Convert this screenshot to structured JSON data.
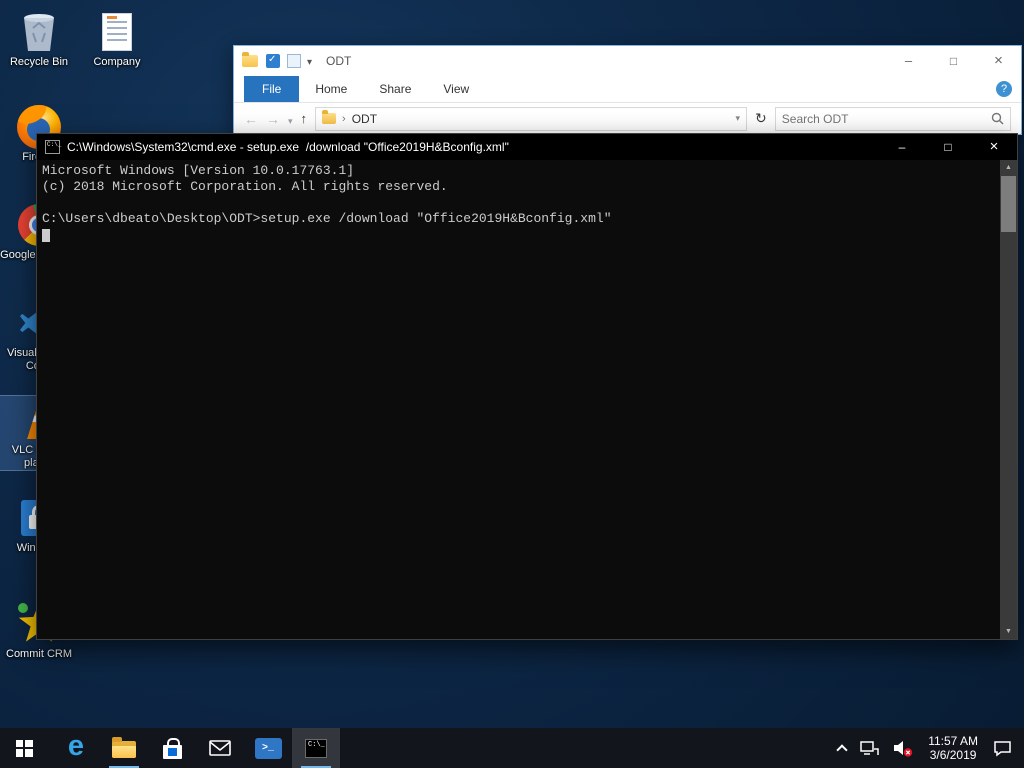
{
  "colors": {
    "accent_blue": "#2873bd",
    "desktop_navy": "#0d2746",
    "console_bg": "#0c0c0c",
    "console_text": "#cccccc",
    "mute_red": "#e81123"
  },
  "desktop": {
    "icons": [
      {
        "name": "recycle-bin",
        "label": "Recycle Bin"
      },
      {
        "name": "company",
        "label": "Company"
      },
      {
        "name": "firefox",
        "label": "Firefox"
      },
      {
        "name": "google-chrome",
        "label": "Google Chrome"
      },
      {
        "name": "visual-studio-code",
        "label": "Visual Studio Code"
      },
      {
        "name": "vlc-media-player",
        "label": "VLC media player",
        "selected": true
      },
      {
        "name": "windows-app",
        "label": "Windows"
      },
      {
        "name": "commit-crm",
        "label": "Commit CRM"
      }
    ]
  },
  "explorer": {
    "title": "ODT",
    "ribbon_tabs": [
      "File",
      "Home",
      "Share",
      "View"
    ],
    "breadcrumb": "ODT",
    "search_placeholder": "Search ODT"
  },
  "cmd": {
    "title": "C:\\Windows\\System32\\cmd.exe - setup.exe  /download \"Office2019H&Bconfig.xml\"",
    "lines": [
      "Microsoft Windows [Version 10.0.17763.1]",
      "(c) 2018 Microsoft Corporation. All rights reserved.",
      "",
      "C:\\Users\\dbeato\\Desktop\\ODT>setup.exe /download \"Office2019H&Bconfig.xml\""
    ]
  },
  "taskbar": {
    "clock": {
      "time": "11:57 AM",
      "date": "3/6/2019"
    }
  }
}
